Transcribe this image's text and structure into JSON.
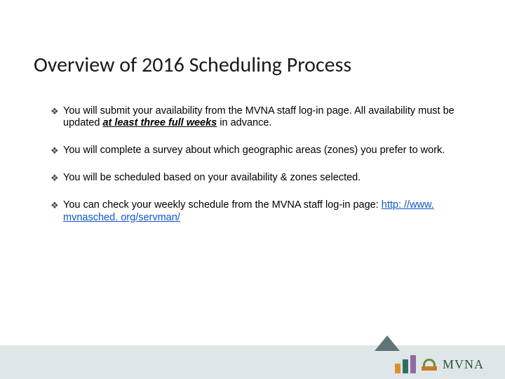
{
  "title": "Overview of 2016 Scheduling Process",
  "bullets": [
    {
      "pre": "You will submit your availability from the MVNA staff log-in page.  All availability must be updated ",
      "em": "at least three full weeks",
      "post": " in advance."
    },
    {
      "pre": "You will complete a survey about which geographic areas (zones) you prefer to work.",
      "em": "",
      "post": ""
    },
    {
      "pre": "You will be scheduled based on your availability & zones selected.",
      "em": "",
      "post": ""
    },
    {
      "pre": "You can check your weekly schedule from the MVNA staff log-in page: ",
      "em": "",
      "post": "",
      "link": "http: //www. mvnasched. org/servman/"
    }
  ],
  "bullet_marker": "❖",
  "logo_text": "MVNA"
}
